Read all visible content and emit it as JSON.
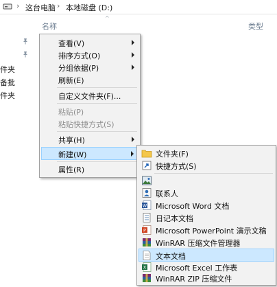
{
  "addressbar": {
    "breadcrumbs": [
      "这台电脑",
      "本地磁盘 (D:)"
    ],
    "separator": "›"
  },
  "columns": {
    "name": "名称",
    "type": "类型"
  },
  "sidebar": {
    "items": [
      "件夹",
      "备批",
      "件夹"
    ]
  },
  "context_menu": {
    "items": [
      {
        "label": "查看(V)",
        "submenu": true
      },
      {
        "label": "排序方式(O)",
        "submenu": true
      },
      {
        "label": "分组依据(P)",
        "submenu": true
      },
      {
        "label": "刷新(E)"
      },
      {
        "label": "自定义文件夹(F)..."
      },
      {
        "label": "粘贴(P)",
        "disabled": true
      },
      {
        "label": "粘贴快捷方式(S)",
        "disabled": true
      },
      {
        "label": "共享(H)",
        "submenu": true
      },
      {
        "label": "新建(W)",
        "submenu": true,
        "highlighted": true
      },
      {
        "label": "属性(R)"
      }
    ]
  },
  "new_submenu": {
    "items": [
      {
        "label": "文件夹(F)",
        "icon": "folder-icon"
      },
      {
        "label": "快捷方式(S)",
        "icon": "shortcut-icon"
      },
      {
        "label": "",
        "icon": "bitmap-image-icon"
      },
      {
        "label": "联系人",
        "icon": "contact-icon"
      },
      {
        "label": "Microsoft Word 文档",
        "icon": "word-icon"
      },
      {
        "label": "日记本文档",
        "icon": "journal-icon"
      },
      {
        "label": "Microsoft PowerPoint 演示文稿",
        "icon": "powerpoint-icon"
      },
      {
        "label": "WinRAR 压缩文件管理器",
        "icon": "winrar-icon"
      },
      {
        "label": "文本文档",
        "icon": "text-document-icon",
        "highlighted": true
      },
      {
        "label": "Microsoft Excel 工作表",
        "icon": "excel-icon"
      },
      {
        "label": "WinRAR ZIP 压缩文件",
        "icon": "winrar-zip-icon"
      }
    ]
  },
  "colors": {
    "menu_bg": "#f2f2f2",
    "highlight": "#cce8ff",
    "highlight_border": "#99d1ff",
    "header_text": "#6b7c8f"
  }
}
